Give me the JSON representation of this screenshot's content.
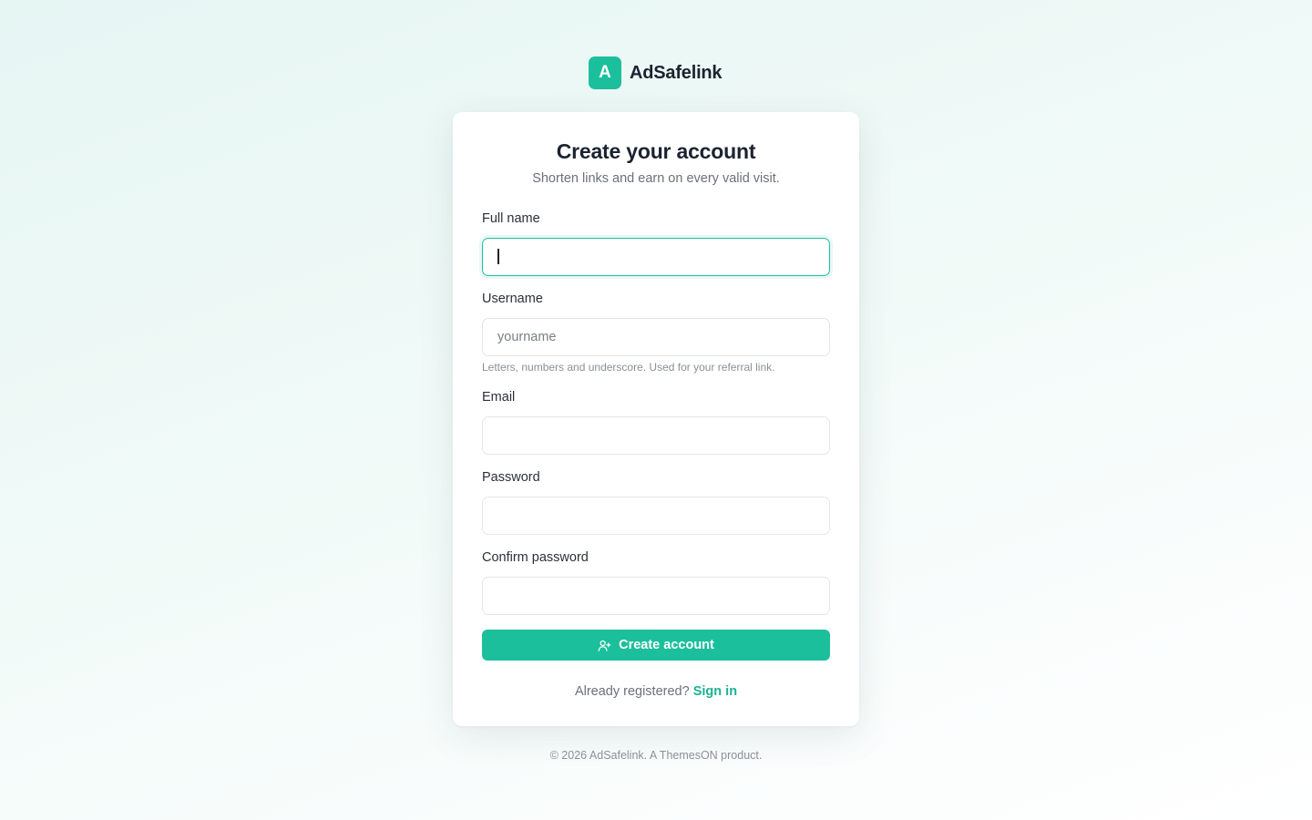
{
  "brand": {
    "mark": "A",
    "name": "AdSafelink",
    "accent_color": "#1cbf9c"
  },
  "form": {
    "title": "Create your account",
    "subtitle": "Shorten links and earn on every valid visit.",
    "fields": [
      {
        "label": "Full name",
        "value": "",
        "placeholder": "",
        "focused": true
      },
      {
        "label": "Username",
        "value": "",
        "placeholder": "yourname",
        "help": "Letters, numbers and underscore. Used for your referral link."
      },
      {
        "label": "Email",
        "value": "",
        "placeholder": ""
      },
      {
        "label": "Password",
        "value": "",
        "placeholder": ""
      },
      {
        "label": "Confirm password",
        "value": "",
        "placeholder": ""
      }
    ],
    "submit_label": "Create account",
    "submit_icon": "user-plus-icon",
    "signin_prompt": "Already registered?",
    "signin_link": "Sign in"
  },
  "footer": {
    "text": "© 2026 AdSafelink. A ThemesON product."
  }
}
